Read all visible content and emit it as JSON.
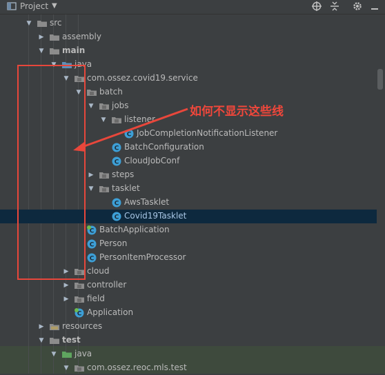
{
  "toolbar": {
    "title": "Project",
    "icons": [
      "project-icon",
      "chevron-down-icon",
      "target-icon",
      "collapse-icon",
      "gear-icon",
      "minimize-icon"
    ]
  },
  "tree": {
    "items": [
      {
        "label": "src",
        "kind": "folder",
        "expanded": true,
        "bold": false
      },
      {
        "label": "assembly",
        "kind": "folder",
        "expanded": false,
        "bold": false
      },
      {
        "label": "main",
        "kind": "folder",
        "expanded": true,
        "bold": true
      },
      {
        "label": "java",
        "kind": "source-folder",
        "expanded": true,
        "bold": false
      },
      {
        "label": "com.ossez.covid19.service",
        "kind": "package",
        "expanded": true,
        "bold": false
      },
      {
        "label": "batch",
        "kind": "package",
        "expanded": true,
        "bold": false
      },
      {
        "label": "jobs",
        "kind": "package",
        "expanded": true,
        "bold": false
      },
      {
        "label": "listener",
        "kind": "package",
        "expanded": true,
        "bold": false
      },
      {
        "label": "JobCompletionNotificationListener",
        "kind": "class",
        "bold": false
      },
      {
        "label": "BatchConfiguration",
        "kind": "class",
        "bold": false
      },
      {
        "label": "CloudJobConf",
        "kind": "class",
        "bold": false
      },
      {
        "label": "steps",
        "kind": "package",
        "expanded": false,
        "bold": false
      },
      {
        "label": "tasklet",
        "kind": "package",
        "expanded": true,
        "bold": false
      },
      {
        "label": "AwsTasklet",
        "kind": "class",
        "bold": false
      },
      {
        "label": "Covid19Tasklet",
        "kind": "class",
        "bold": false,
        "selected": true
      },
      {
        "label": "BatchApplication",
        "kind": "spring-class",
        "bold": false
      },
      {
        "label": "Person",
        "kind": "class",
        "bold": false
      },
      {
        "label": "PersonItemProcessor",
        "kind": "class",
        "bold": false
      },
      {
        "label": "cloud",
        "kind": "package",
        "expanded": false,
        "bold": false
      },
      {
        "label": "controller",
        "kind": "package",
        "expanded": false,
        "bold": false
      },
      {
        "label": "field",
        "kind": "package",
        "expanded": false,
        "bold": false
      },
      {
        "label": "Application",
        "kind": "spring-class",
        "bold": false
      },
      {
        "label": "resources",
        "kind": "resources-folder",
        "expanded": false,
        "bold": false
      },
      {
        "label": "test",
        "kind": "folder",
        "expanded": true,
        "bold": true
      },
      {
        "label": "java",
        "kind": "test-folder",
        "expanded": true,
        "bold": false
      },
      {
        "label": "com.ossez.reoc.mls.test",
        "kind": "package",
        "expanded": true,
        "bold": false
      }
    ]
  },
  "annotation": {
    "text": "如何不显示这些线",
    "color": "#e8473b"
  },
  "colors": {
    "background": "#3c3f41",
    "selection": "#0d293e",
    "folder": "#8c8c8c",
    "class_icon": "#3d9fd6",
    "test_folder": "#5fa55f",
    "annotation": "#e8473b"
  }
}
